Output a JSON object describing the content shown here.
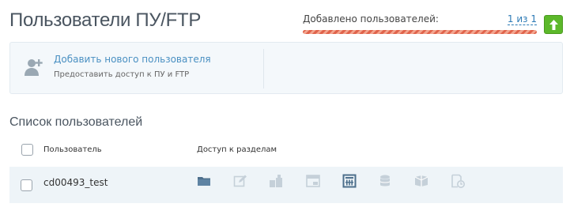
{
  "header": {
    "title": "Пользователи ПУ/FTP"
  },
  "quota": {
    "label": "Добавлено пользователей:",
    "count": "1 из 1",
    "fill": 1.0,
    "bar_color": "#e0634b"
  },
  "upgrade": {
    "icon": "arrow-up-icon",
    "color": "#5cb82a"
  },
  "add_user": {
    "title": "Добавить нового пользователя",
    "description": "Предоставить доступ к ПУ и FTP",
    "icon": "add-user-icon"
  },
  "users_section": {
    "title": "Список пользователей",
    "columns": {
      "user": "Пользователь",
      "access": "Доступ к разделам"
    },
    "rows": [
      {
        "name": "cd00493_test",
        "checked": false,
        "access_icons": [
          {
            "icon": "folder-icon",
            "active": true
          },
          {
            "icon": "edit-icon",
            "active": false
          },
          {
            "icon": "apps-icon",
            "active": false
          },
          {
            "icon": "hosting-icon",
            "active": false
          },
          {
            "icon": "calculator-icon",
            "active": true
          },
          {
            "icon": "database-icon",
            "active": false
          },
          {
            "icon": "mail-icon",
            "active": false
          },
          {
            "icon": "schedule-icon",
            "active": false
          }
        ]
      }
    ]
  },
  "colors": {
    "link": "#2d7bb6",
    "icon_active": "#4d6f8c",
    "icon_inactive": "#c5d0d9"
  }
}
